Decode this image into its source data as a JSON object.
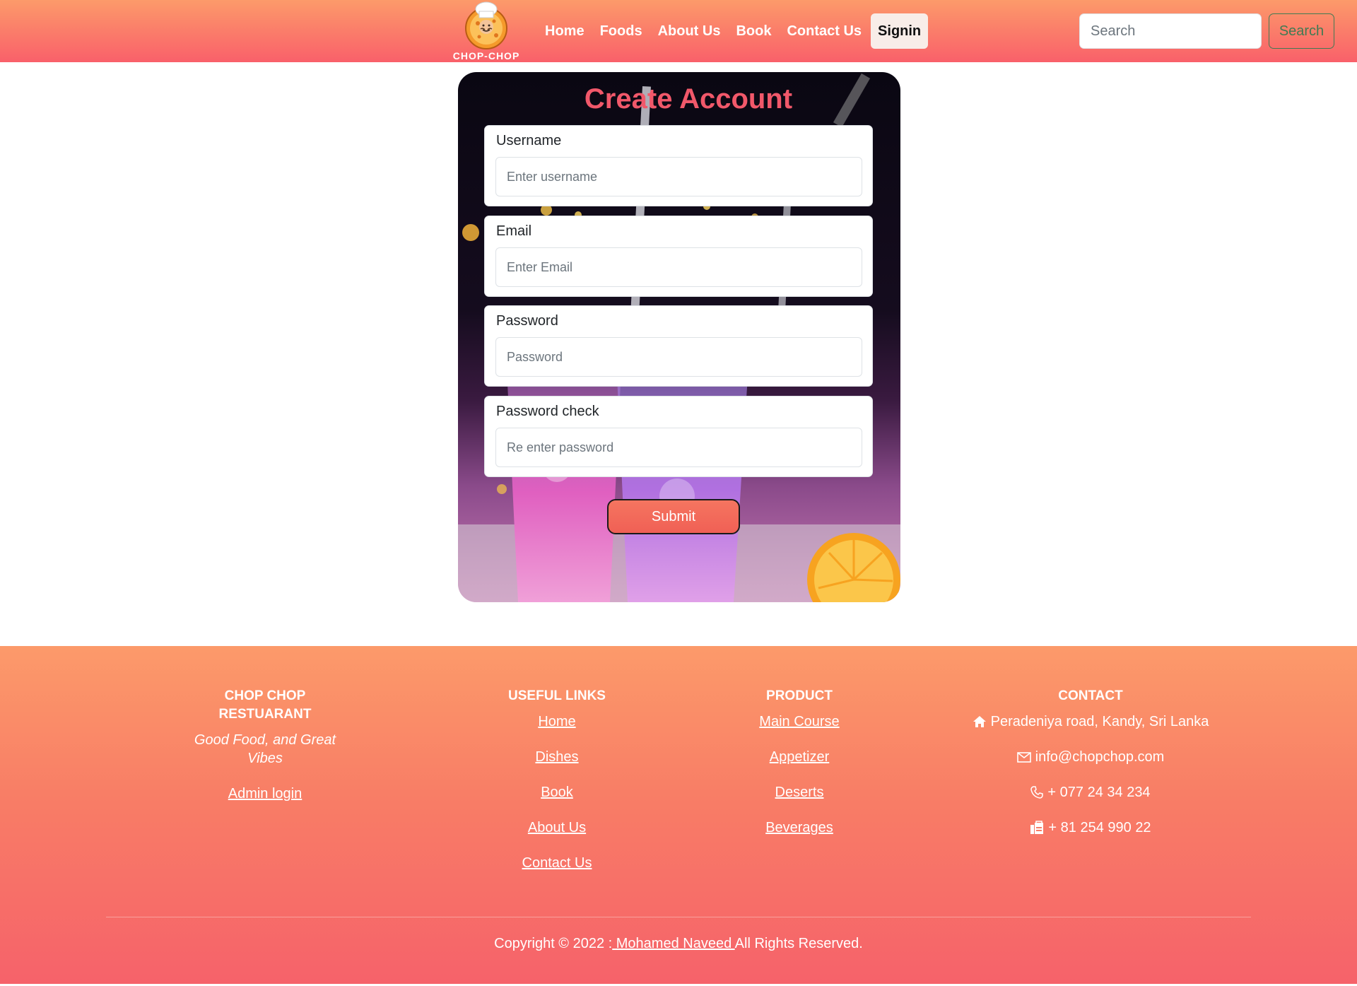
{
  "navbar": {
    "logo_text": "CHOP-CHOP",
    "links": [
      "Home",
      "Foods",
      "About Us",
      "Book",
      "Contact Us"
    ],
    "signin_label": "Signin",
    "search_placeholder": "Search",
    "search_button": "Search"
  },
  "form": {
    "title": "Create Account",
    "fields": [
      {
        "label": "Username",
        "placeholder": "Enter username"
      },
      {
        "label": "Email",
        "placeholder": "Enter Email"
      },
      {
        "label": "Password",
        "placeholder": "Password"
      },
      {
        "label": "Password check",
        "placeholder": "Re enter password"
      }
    ],
    "submit_label": "Submit"
  },
  "footer": {
    "brand": {
      "heading": "CHOP CHOP RESTUARANT",
      "tagline": "Good Food, and Great Vibes",
      "admin_link": "Admin login"
    },
    "useful_links": {
      "heading": "USEFUL LINKS",
      "items": [
        "Home",
        "Dishes",
        "Book",
        "About Us",
        "Contact Us"
      ]
    },
    "product": {
      "heading": "PRODUCT",
      "items": [
        "Main Course",
        "Appetizer",
        "Deserts",
        "Beverages"
      ]
    },
    "contact": {
      "heading": "CONTACT",
      "address": "Peradeniya road, Kandy, Sri Lanka",
      "email": "info@chopchop.com",
      "phone": "+ 077 24 34 234",
      "fax": "+ 81 254 990 22"
    },
    "copyright_prefix": "Copyright © 2022 :",
    "copyright_author": " Mohamed Naveed ",
    "copyright_suffix": "All Rights Reserved."
  },
  "colors": {
    "header_top": "#fc9a6a",
    "header_bottom": "#f9606a",
    "title": "#f1586a",
    "search_button": "#3f7b53"
  }
}
